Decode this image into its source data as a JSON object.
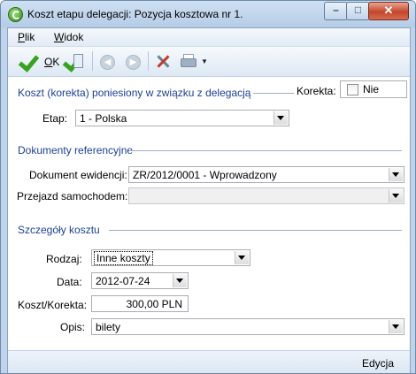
{
  "window": {
    "title": "Koszt etapu delegacji: Pozycja kosztowa nr 1."
  },
  "menu": [
    {
      "key": "P",
      "rest": "lik"
    },
    {
      "key": "W",
      "rest": "idok"
    }
  ],
  "toolbar": {
    "ok_key": "O",
    "ok_rest": "K"
  },
  "section1": {
    "title": "Koszt (korekta) poniesiony w związku z delegacją",
    "korekta_label": "Korekta:",
    "korekta_value": "Nie",
    "etap_label": "Etap:",
    "etap_value": "1 - Polska"
  },
  "section2": {
    "title": "Dokumenty referencyjne",
    "dokument_label": "Dokument ewidencji:",
    "dokument_value": "ZR/2012/0001 - Wprowadzony",
    "przejazd_label": "Przejazd samochodem:",
    "przejazd_value": ""
  },
  "section3": {
    "title": "Szczegóły kosztu",
    "rodzaj_label": "Rodzaj:",
    "rodzaj_value": "Inne koszty",
    "data_label": "Data:",
    "data_value": "2012-07-24",
    "koszt_label": "Koszt/Korekta:",
    "koszt_value": "300,00 PLN",
    "opis_label": "Opis:",
    "opis_value": "bilety"
  },
  "status": {
    "mode": "Edycja"
  },
  "icons": [
    "app-icon",
    "minimize-icon",
    "maximize-icon",
    "close-icon",
    "ok-check-icon",
    "save-new-icon",
    "back-arrow-icon",
    "forward-arrow-icon",
    "tools-icon",
    "printer-icon",
    "dropdown-arrow-icon"
  ]
}
